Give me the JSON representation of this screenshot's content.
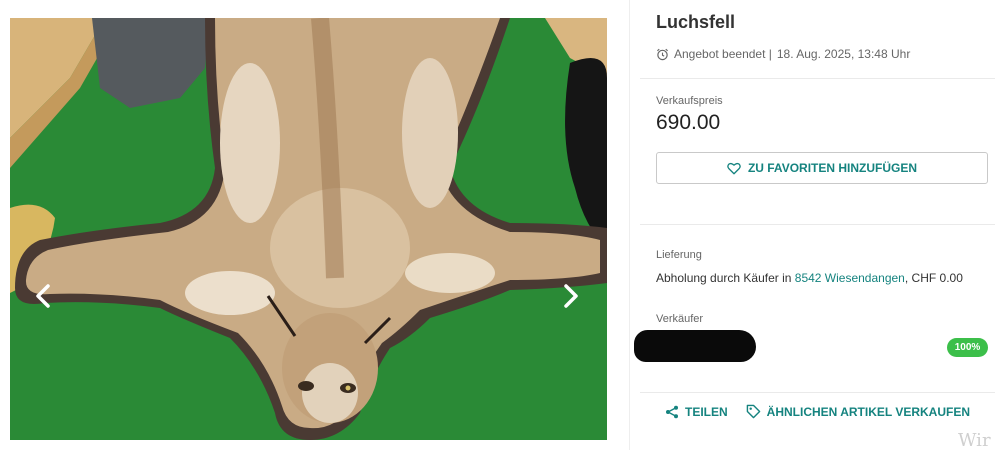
{
  "listing": {
    "title": "Luchsfell",
    "status": "Angebot beendet |",
    "end_date": "18. Aug. 2025, 13:48 Uhr"
  },
  "price": {
    "label": "Verkaufspreis",
    "value": "690.00"
  },
  "favorite_button": {
    "label": "ZU FAVORITEN HINZUFÜGEN"
  },
  "delivery": {
    "label": "Lieferung",
    "text_prefix": "Abholung durch Käufer in ",
    "location_link": "8542 Wiesendangen",
    "text_suffix": ", CHF 0.00"
  },
  "seller": {
    "label": "Verkäufer",
    "rating": "100%"
  },
  "actions": {
    "share": "TEILEN",
    "sell_similar": "ÄHNLICHEN ARTIKEL VERKAUFEN"
  },
  "watermark": "Wir",
  "colors": {
    "accent": "#15837f",
    "rating": "#3cbf4a"
  },
  "icons": {
    "status": "alarm-clock-icon",
    "favorite": "heart-icon",
    "share": "share-icon",
    "sell_similar": "tag-icon",
    "gallery_prev": "chevron-left-icon",
    "gallery_next": "chevron-right-icon"
  }
}
